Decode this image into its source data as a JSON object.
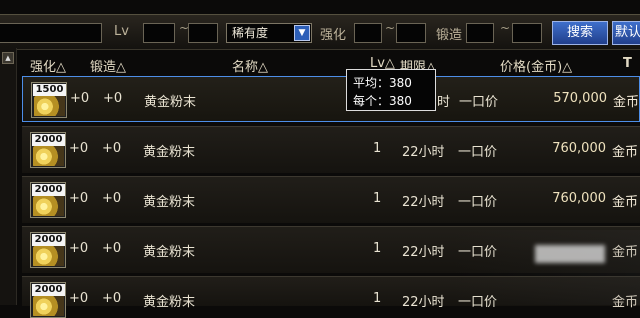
{
  "search": {
    "lv_label": "Lv",
    "tilde": "~",
    "rarity_value": "稀有度",
    "enhance_label": "强化",
    "forge_label": "锻造",
    "search_button": "搜索",
    "default_button": "默认"
  },
  "headers": {
    "enhance": "强化△",
    "forge": "锻造△",
    "name": "名称△",
    "lv": "Lv△",
    "term": "期限△",
    "price": "价格(金币)△"
  },
  "tooltip": {
    "avg_label": "平均：380",
    "each_label": "每个：380"
  },
  "rows": [
    {
      "stack": "1500",
      "enhance": "+0",
      "forge": "+0",
      "name": "黄金粉末",
      "lv": "",
      "term": "时",
      "type": "一口价",
      "price": "570,000",
      "unit": "金币"
    },
    {
      "stack": "2000",
      "enhance": "+0",
      "forge": "+0",
      "name": "黄金粉末",
      "lv": "1",
      "term": "22小时",
      "type": "一口价",
      "price": "760,000",
      "unit": "金币"
    },
    {
      "stack": "2000",
      "enhance": "+0",
      "forge": "+0",
      "name": "黄金粉末",
      "lv": "1",
      "term": "22小时",
      "type": "一口价",
      "price": "760,000",
      "unit": "金币"
    },
    {
      "stack": "2000",
      "enhance": "+0",
      "forge": "+0",
      "name": "黄金粉末",
      "lv": "1",
      "term": "22小时",
      "type": "一口价",
      "price": "",
      "unit": "金币"
    },
    {
      "stack": "2000",
      "enhance": "+0",
      "forge": "+0",
      "name": "黄金粉末",
      "lv": "1",
      "term": "22小时",
      "type": "一口价",
      "price": "",
      "unit": "金币"
    }
  ]
}
